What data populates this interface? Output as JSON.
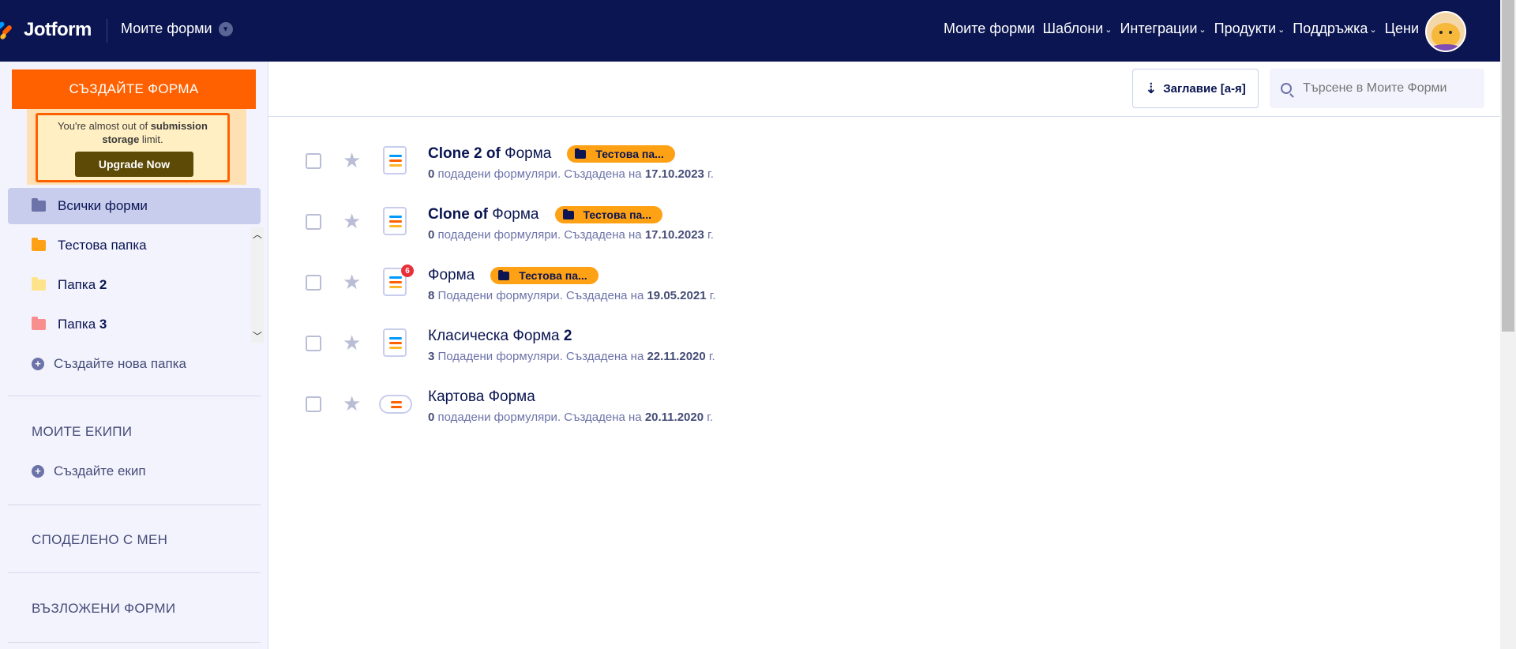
{
  "header": {
    "logo": "Jotform",
    "workspace_dropdown": "Моите форми",
    "nav": [
      {
        "label": "Моите форми",
        "has_dropdown": false
      },
      {
        "label": "Шаблони",
        "has_dropdown": true
      },
      {
        "label": "Интеграции",
        "has_dropdown": true
      },
      {
        "label": "Продукти",
        "has_dropdown": true
      },
      {
        "label": "Поддръжка",
        "has_dropdown": true
      },
      {
        "label": "Цени",
        "has_dropdown": false
      }
    ]
  },
  "sidebar": {
    "create_button": "СЪЗДАЙТЕ ФОРМА",
    "promo": {
      "text_before": "You're almost out of ",
      "text_bold": "submission storage",
      "text_after": " limit.",
      "button": "Upgrade Now"
    },
    "folders": [
      {
        "name": "Всички форми",
        "suffix": "",
        "color": "#6c73a8",
        "active": true
      },
      {
        "name": "Тестова папка",
        "suffix": "",
        "color": "#ffa114",
        "active": false
      },
      {
        "name": "Папка ",
        "suffix": "2",
        "color": "#ffe38a",
        "active": false
      },
      {
        "name": "Папка ",
        "suffix": "3",
        "color": "#f98e8e",
        "active": false
      }
    ],
    "new_folder": "Създайте нова папка",
    "teams_title": "МОИТЕ ЕКИПИ",
    "create_team": "Създайте екип",
    "shared_title": "СПОДЕЛЕНО С МЕН",
    "assigned_title": "ВЪЗЛОЖЕНИ ФОРМИ"
  },
  "toolbar": {
    "sort_label": "Заглавие [а-я]",
    "search_placeholder": "Търсене в Моите Форми"
  },
  "forms": [
    {
      "title_bold": "Clone 2 of",
      "title_rest": " Форма",
      "tag": "Тестова па...",
      "count": "0",
      "count_label": " подадени формуляри. Създадена на ",
      "date": "17.10.2023",
      "date_suffix": " г.",
      "icon": "form-icon",
      "badge": ""
    },
    {
      "title_bold": "Clone of",
      "title_rest": " Форма",
      "tag": "Тестова па...",
      "count": "0",
      "count_label": " подадени формуляри. Създадена на ",
      "date": "17.10.2023",
      "date_suffix": " г.",
      "icon": "form-icon",
      "badge": ""
    },
    {
      "title_bold": "",
      "title_rest": "Форма",
      "tag": "Тестова па...",
      "count": "8",
      "count_label": " Подадени формуляри. Създадена на ",
      "date": "19.05.2021",
      "date_suffix": " г.",
      "icon": "form-icon",
      "badge": "6"
    },
    {
      "title_bold": "",
      "title_rest": "Класическа Форма ",
      "title_bold_end": "2",
      "tag": "",
      "count": "3",
      "count_label": " Подадени формуляри. Създадена на ",
      "date": "22.11.2020",
      "date_suffix": " г.",
      "icon": "form-icon",
      "badge": ""
    },
    {
      "title_bold": "",
      "title_rest": "Картова Форма",
      "tag": "",
      "count": "0",
      "count_label": " подадени формуляри. Създадена на ",
      "date": "20.11.2020",
      "date_suffix": " г.",
      "icon": "card-form-icon",
      "badge": ""
    }
  ]
}
